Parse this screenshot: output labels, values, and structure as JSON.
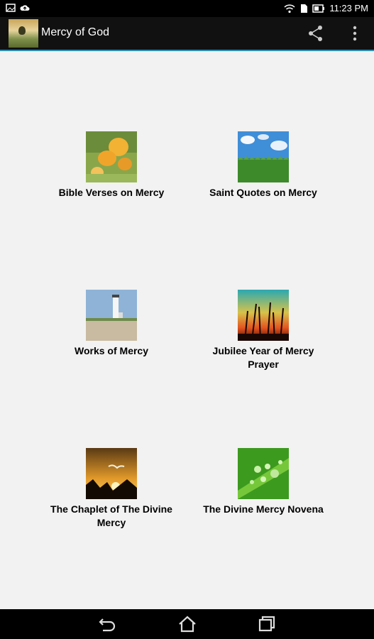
{
  "status_bar": {
    "time": "11:23 PM",
    "left_icons": [
      "image-notification-icon",
      "upload-cloud-icon"
    ],
    "right_icons": [
      "wifi-icon",
      "sim-icon",
      "battery-icon"
    ]
  },
  "app_bar": {
    "title": "Mercy of God",
    "actions": [
      "share-icon",
      "overflow-menu-icon"
    ]
  },
  "menu_items": [
    {
      "label": "Bible Verses on Mercy",
      "image": "yellow-flowers"
    },
    {
      "label": "Saint Quotes on Mercy",
      "image": "field-blue-sky"
    },
    {
      "label": "Works of Mercy",
      "image": "lighthouse-beach"
    },
    {
      "label": "Jubilee Year of Mercy Prayer",
      "image": "sunset-grass"
    },
    {
      "label": "The Chaplet of The Divine Mercy",
      "image": "bird-sunset-mountains"
    },
    {
      "label": "The Divine Mercy Novena",
      "image": "water-drops-leaf"
    }
  ],
  "nav_bar": {
    "buttons": [
      "back-icon",
      "home-icon",
      "recent-apps-icon"
    ]
  }
}
